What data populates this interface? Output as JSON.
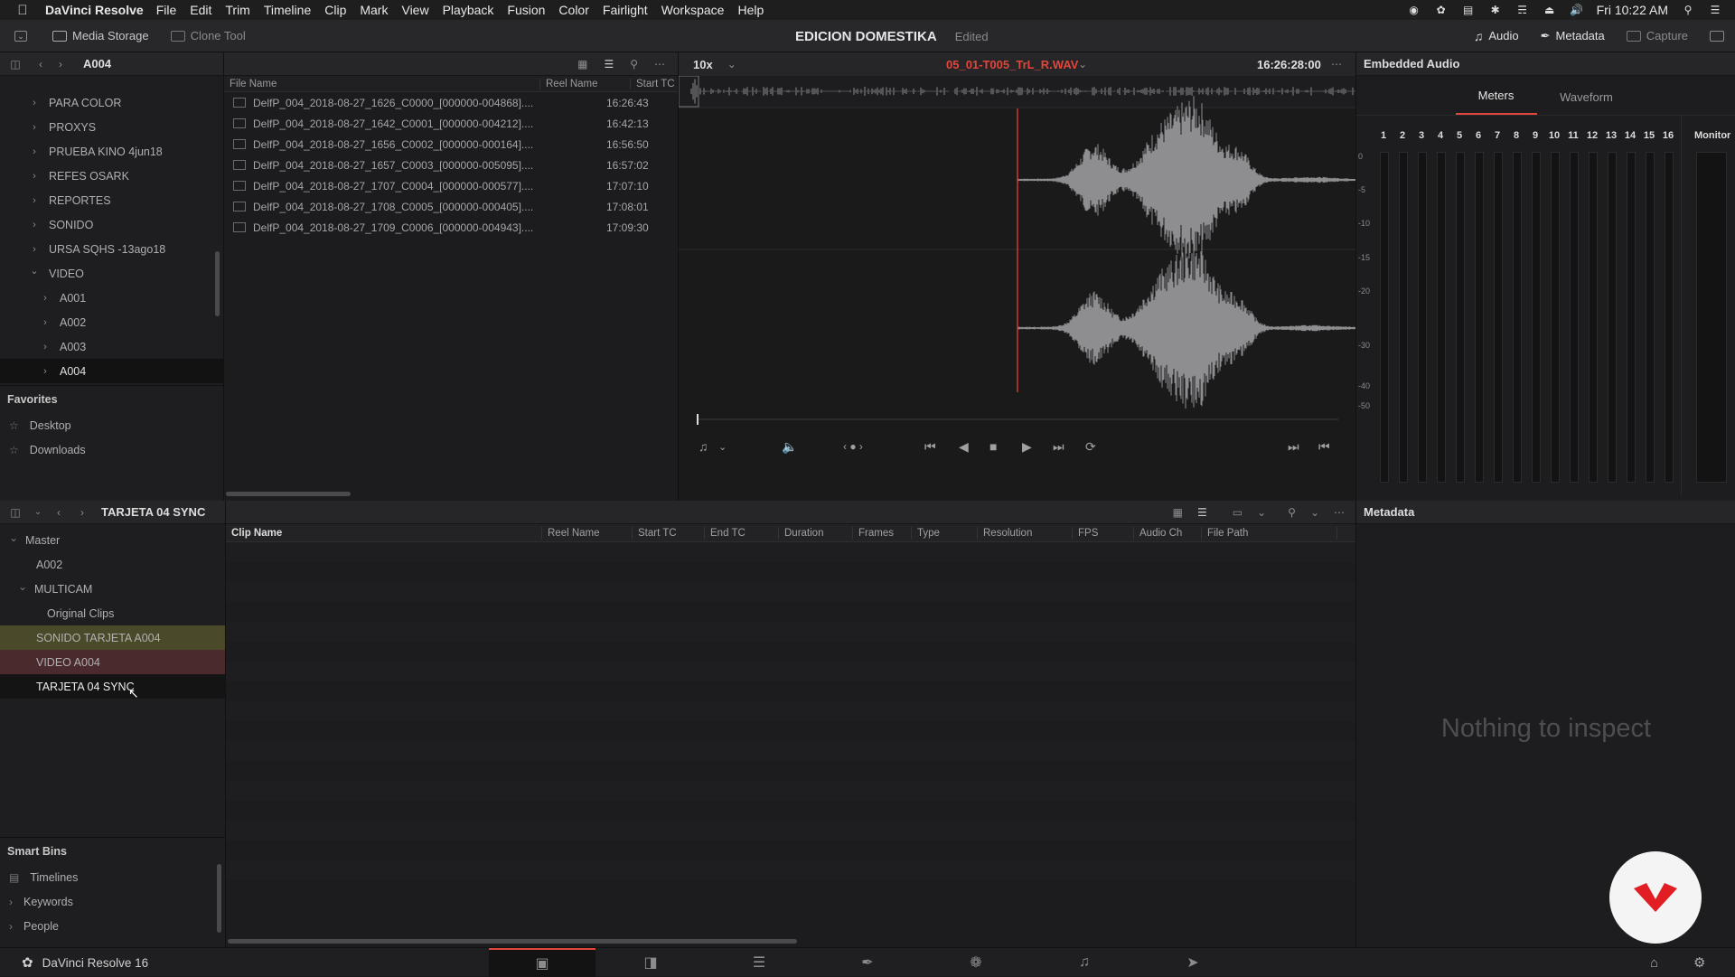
{
  "menubar": {
    "app": "DaVinci Resolve",
    "items": [
      "File",
      "Edit",
      "Trim",
      "Timeline",
      "Clip",
      "Mark",
      "View",
      "Playback",
      "Fusion",
      "Color",
      "Fairlight",
      "Workspace",
      "Help"
    ],
    "clock": "Fri 10:22 AM"
  },
  "toolbar": {
    "media_storage": "Media Storage",
    "clone_tool": "Clone Tool",
    "project_title": "EDICION DOMESTIKA",
    "project_status": "Edited",
    "audio": "Audio",
    "metadata": "Metadata",
    "capture": "Capture"
  },
  "media_storage": {
    "current_folder": "A004",
    "tree": [
      {
        "label": "PARA COLOR",
        "level": 1,
        "expanded": false
      },
      {
        "label": "PROXYS",
        "level": 1,
        "expanded": false
      },
      {
        "label": "PRUEBA KINO 4jun18",
        "level": 1,
        "expanded": false
      },
      {
        "label": "REFES OSARK",
        "level": 1,
        "expanded": false
      },
      {
        "label": "REPORTES",
        "level": 1,
        "expanded": false
      },
      {
        "label": "SONIDO",
        "level": 1,
        "expanded": false
      },
      {
        "label": "URSA SQHS -13ago18",
        "level": 1,
        "expanded": false
      },
      {
        "label": "VIDEO",
        "level": 1,
        "expanded": true
      },
      {
        "label": "A001",
        "level": 2,
        "expanded": false
      },
      {
        "label": "A002",
        "level": 2,
        "expanded": false
      },
      {
        "label": "A003",
        "level": 2,
        "expanded": false
      },
      {
        "label": "A004",
        "level": 2,
        "expanded": false,
        "selected": true
      }
    ],
    "favorites_title": "Favorites",
    "favorites": [
      "Desktop",
      "Downloads"
    ]
  },
  "file_list": {
    "columns": [
      "File Name",
      "Reel Name",
      "Start TC"
    ],
    "rows": [
      {
        "name": "DelfP_004_2018-08-27_1626_C0000_[000000-004868]....",
        "tc": "16:26:43"
      },
      {
        "name": "DelfP_004_2018-08-27_1642_C0001_[000000-004212]....",
        "tc": "16:42:13"
      },
      {
        "name": "DelfP_004_2018-08-27_1656_C0002_[000000-000164]....",
        "tc": "16:56:50"
      },
      {
        "name": "DelfP_004_2018-08-27_1657_C0003_[000000-005095]....",
        "tc": "16:57:02"
      },
      {
        "name": "DelfP_004_2018-08-27_1707_C0004_[000000-000577]....",
        "tc": "17:07:10"
      },
      {
        "name": "DelfP_004_2018-08-27_1708_C0005_[000000-000405]....",
        "tc": "17:08:01"
      },
      {
        "name": "DelfP_004_2018-08-27_1709_C0006_[000000-004943]....",
        "tc": "17:09:30"
      }
    ]
  },
  "viewer": {
    "zoom": "10x",
    "clip_name": "05_01-T005_TrL_R.WAV",
    "timecode": "16:26:28:00"
  },
  "embedded_audio": {
    "title": "Embedded Audio",
    "tabs": [
      "Meters",
      "Waveform"
    ],
    "active_tab": "Meters",
    "channels": [
      "1",
      "2",
      "3",
      "4",
      "5",
      "6",
      "7",
      "8",
      "9",
      "10",
      "11",
      "12",
      "13",
      "14",
      "15",
      "16"
    ],
    "monitor_label": "Monitor",
    "scale": [
      "0",
      "-5",
      "-10",
      "-15",
      "-20",
      "-30",
      "-40",
      "-50"
    ]
  },
  "media_pool": {
    "current_bin": "TARJETA 04 SYNC",
    "bins": [
      {
        "label": "Master",
        "level": 0,
        "chev": "down"
      },
      {
        "label": "A002",
        "level": 1,
        "chev": ""
      },
      {
        "label": "MULTICAM",
        "level": 1,
        "chev": "down"
      },
      {
        "label": "Original Clips",
        "level": 2,
        "chev": ""
      },
      {
        "label": "SONIDO TARJETA A004",
        "level": 1,
        "chev": "",
        "bg": "#4a4a2a"
      },
      {
        "label": "VIDEO A004",
        "level": 1,
        "chev": "",
        "bg": "#4a2a2c"
      },
      {
        "label": "TARJETA 04 SYNC",
        "level": 1,
        "chev": "",
        "selected": true
      }
    ],
    "smart_bins_title": "Smart Bins",
    "smart_bins": [
      {
        "label": "Timelines",
        "kind": "icon"
      },
      {
        "label": "Keywords",
        "kind": "chev"
      },
      {
        "label": "People",
        "kind": "chev"
      }
    ],
    "columns": [
      "Clip Name",
      "Reel Name",
      "Start TC",
      "End TC",
      "Duration",
      "Frames",
      "Type",
      "Resolution",
      "FPS",
      "Audio Ch",
      "File Path"
    ]
  },
  "metadata_panel": {
    "title": "Metadata",
    "empty": "Nothing to inspect"
  },
  "statusbar": {
    "app_version": "DaVinci Resolve 16"
  },
  "colors": {
    "accent_red": "#e2463a",
    "playhead": "#c83c34"
  }
}
